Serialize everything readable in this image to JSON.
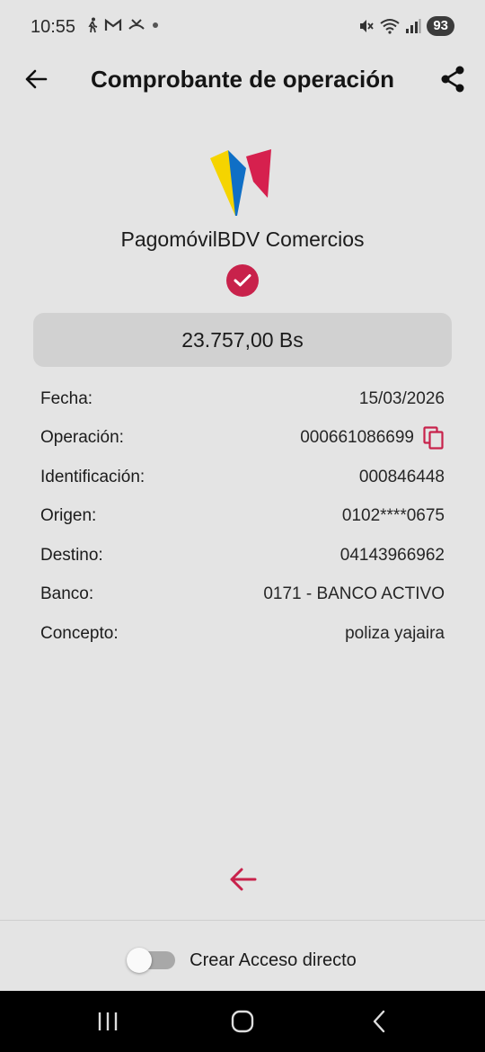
{
  "status_bar": {
    "time": "10:55",
    "left_icons": [
      "walk-icon",
      "gmail-icon",
      "missed-call-icon",
      "dot-icon"
    ],
    "right_icons": [
      "mute-icon",
      "wifi-icon",
      "signal-icon"
    ],
    "battery": "93"
  },
  "header": {
    "title": "Comprobante de operación",
    "back_icon": "arrow-left-icon",
    "share_icon": "share-icon"
  },
  "brand": {
    "name": "PagomóvilBDV Comercios",
    "logo_colors": [
      "#f5d400",
      "#0f6fc6",
      "#d6204e"
    ],
    "status_icon": "check-circle-icon",
    "status_color": "#c8224b"
  },
  "amount": "23.757,00 Bs",
  "details": [
    {
      "label": "Fecha:",
      "value": "15/03/2026"
    },
    {
      "label": "Operación:",
      "value": "000661086699",
      "icon": "copy-icon"
    },
    {
      "label": "Identificación:",
      "value": "000846448"
    },
    {
      "label": "Origen:",
      "value": "0102****0675"
    },
    {
      "label": "Destino:",
      "value": "04143966962"
    },
    {
      "label": "Banco:",
      "value": "0171 - BANCO ACTIVO"
    },
    {
      "label": "Concepto:",
      "value": "poliza yajaira"
    }
  ],
  "accent_color": "#c8224b",
  "shortcut": {
    "label": "Crear Acceso directo",
    "enabled": false
  },
  "nav": [
    "recents-icon",
    "home-icon",
    "back-icon"
  ]
}
